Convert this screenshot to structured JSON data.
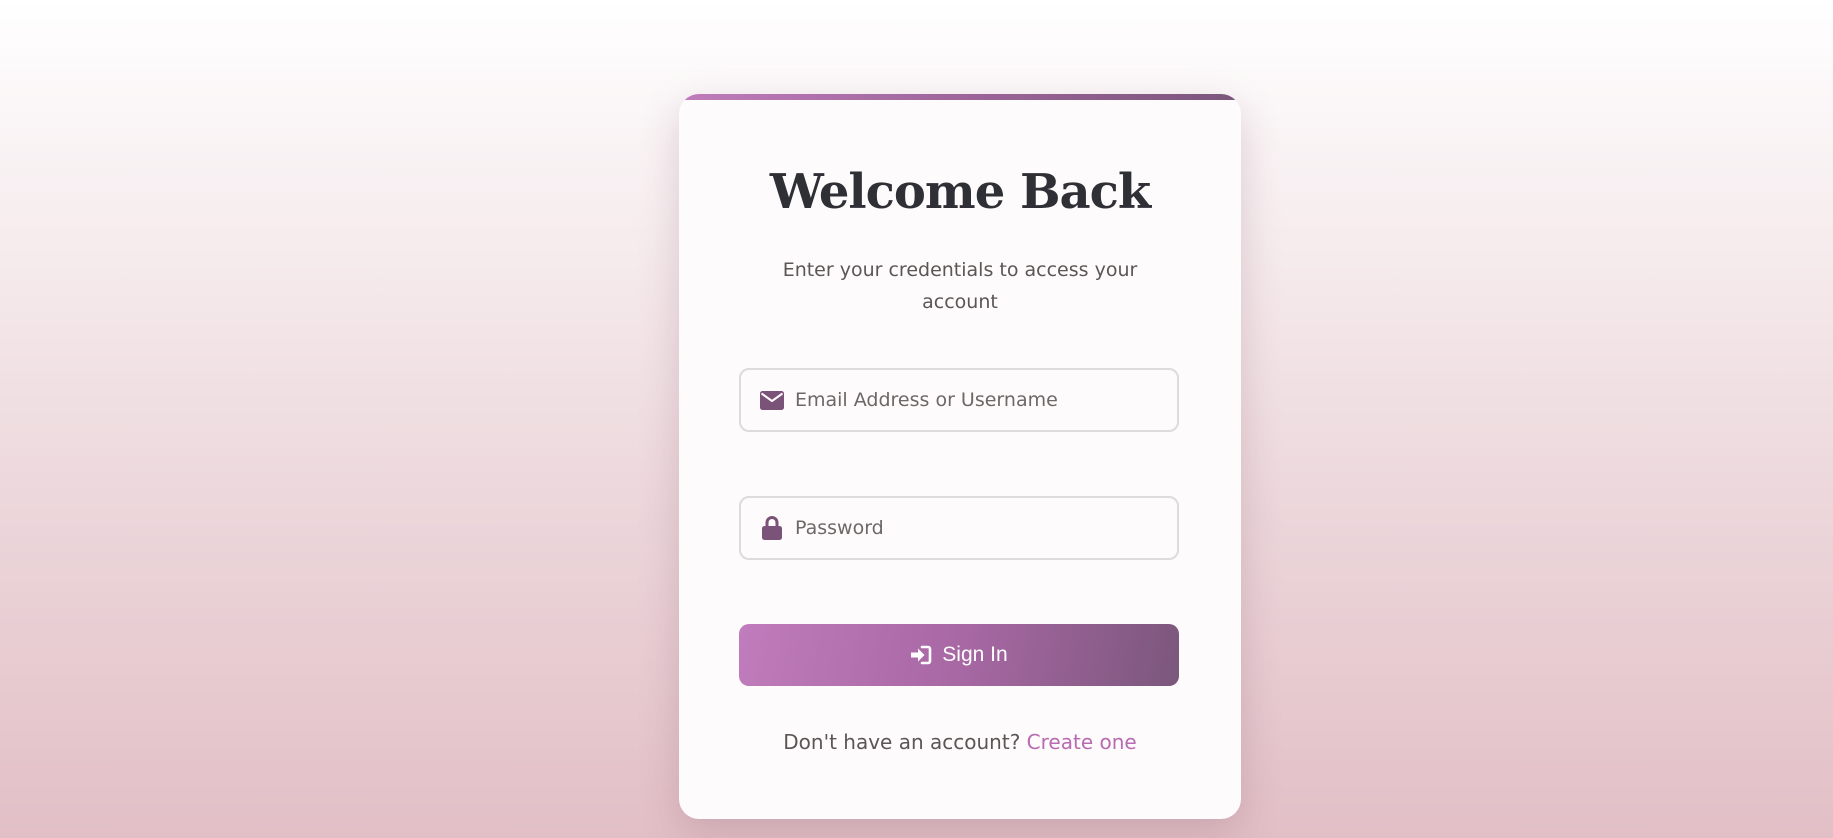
{
  "login": {
    "title": "Welcome Back",
    "subtitle": "Enter your credentials to access your account",
    "email_field": {
      "placeholder": "Email Address or Username",
      "value": "",
      "icon": "envelope-icon"
    },
    "password_field": {
      "placeholder": "Password",
      "value": "",
      "icon": "lock-icon"
    },
    "signin_button": {
      "label": "Sign In",
      "icon": "sign-in-icon"
    },
    "footer": {
      "prompt": "Don't have an account?",
      "link_label": "Create one"
    }
  },
  "colors": {
    "accent": "#c07cbc",
    "accent_dark": "#7b567b",
    "icon": "#7b5378",
    "title": "#2f2f36",
    "text": "#5b5656"
  }
}
